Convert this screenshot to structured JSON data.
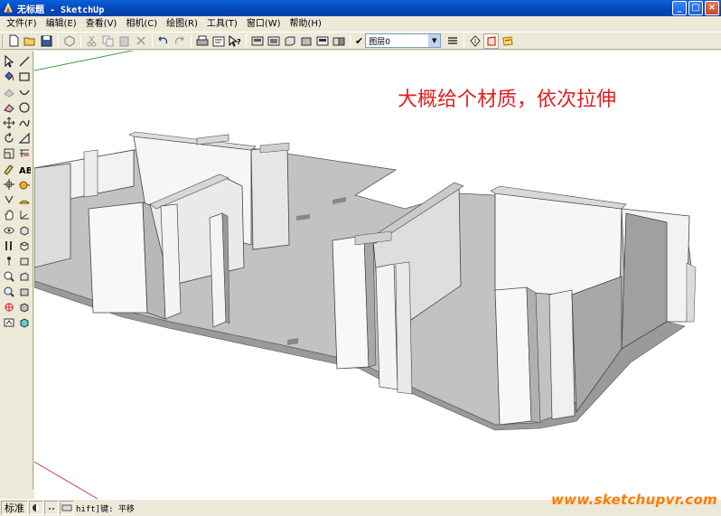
{
  "window": {
    "title": "无标题 - SketchUp",
    "buttons": [
      "_",
      "□",
      "×"
    ]
  },
  "menu": {
    "items": [
      "文件(F)",
      "编辑(E)",
      "查看(V)",
      "相机(C)",
      "绘图(R)",
      "工具(T)",
      "窗口(W)",
      "帮助(H)"
    ]
  },
  "toolbar": {
    "icons": [
      "new-file-icon",
      "open-folder-icon",
      "save-icon",
      "make-component-icon",
      "cut-icon",
      "copy-icon",
      "paste-icon",
      "erase-icon",
      "undo-icon",
      "redo-icon",
      "print-icon",
      "model-info-icon",
      "whats-this-icon",
      "iso-view-icon",
      "top-view-icon",
      "front-view-icon",
      "right-view-icon",
      "back-view-icon",
      "left-view-icon",
      "layer-manager-icon",
      "section-plane-icon",
      "section-display-icon",
      "section-cut-icon"
    ],
    "layer_check": "✔",
    "layer_value": "图层0"
  },
  "lefttoolbar": {
    "icons": [
      "select-icon",
      "line-icon",
      "paint-bucket-icon",
      "rectangle-icon",
      "make-component-icon",
      "arc-icon",
      "eraser-icon",
      "circle-icon",
      "move-icon",
      "freehand-icon",
      "rotate-icon",
      "polygon-icon",
      "scale-icon",
      "offset-icon",
      "push-pull-icon",
      "text-icon",
      "follow-me-icon",
      "tape-measure-icon",
      "orbit-icon",
      "protractor-icon",
      "pan-icon",
      "axes-icon",
      "walk-icon",
      "iso-view-icon",
      "look-around-icon",
      "top-view-icon",
      "position-camera-icon",
      "front-view-icon",
      "zoom-icon",
      "right-view-icon",
      "zoom-window-icon",
      "back-view-icon",
      "zoom-extents-icon",
      "left-view-icon",
      "previous-view-icon",
      "bottom-view-icon"
    ]
  },
  "viewport": {
    "annotation": "大概给个材质，依次拉伸"
  },
  "statusbar": {
    "standard_label": "标准",
    "hint": "hift]键: 平移",
    "watermark": "www.sketchupvr.com"
  },
  "colors": {
    "title_blue": "#0447b8",
    "annotation_red": "#e02020",
    "watermark_orange": "#ff7a00",
    "floor_gray": "#c0c0c0",
    "wall_light": "#f4f4f4",
    "wall_shadow": "#a8a8a8"
  }
}
